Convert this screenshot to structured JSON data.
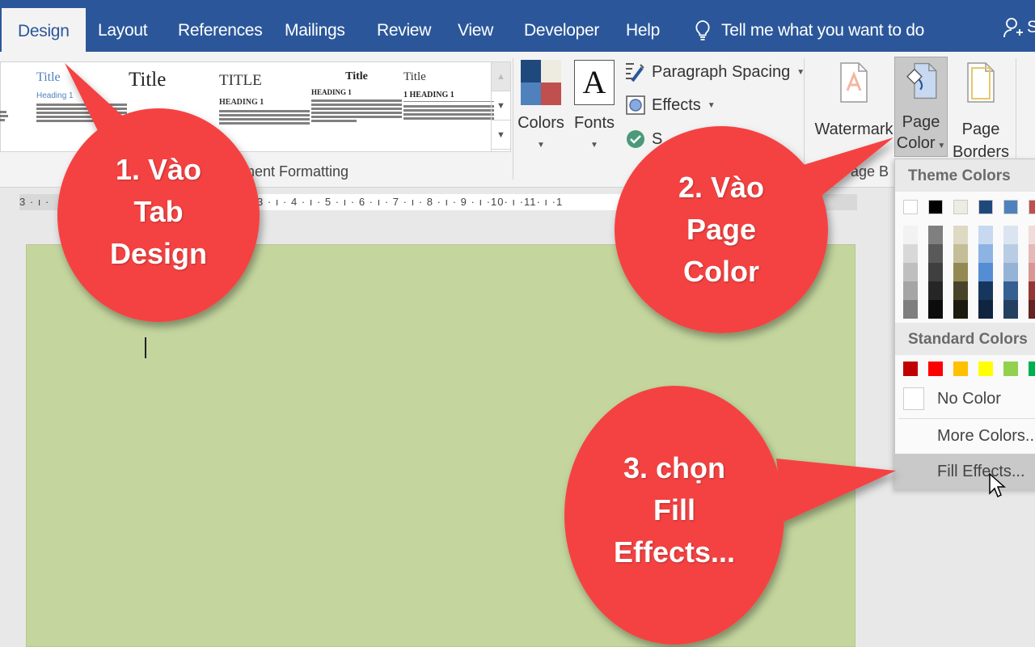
{
  "tabs": [
    {
      "label": "Design",
      "active": true
    },
    {
      "label": "Layout"
    },
    {
      "label": "References"
    },
    {
      "label": "Mailings"
    },
    {
      "label": "Review"
    },
    {
      "label": "View"
    },
    {
      "label": "Developer"
    },
    {
      "label": "Help"
    }
  ],
  "tell_me": {
    "icon": "lightbulb-icon",
    "placeholder": "Tell me what you want to do"
  },
  "share": {
    "icon": "add-person-icon",
    "label": "S"
  },
  "gallery": {
    "thumbnails": [
      {
        "title": "",
        "heading": ""
      },
      {
        "title": "Title",
        "heading": "Heading 1"
      },
      {
        "title": "Title",
        "heading": ""
      },
      {
        "title": "TITLE",
        "heading": "HEADING 1"
      },
      {
        "title": "Title",
        "heading": "HEADING 1"
      },
      {
        "title": "Title",
        "heading": "1  HEADING 1"
      }
    ],
    "group_label": "Document Formatting",
    "group_label_visible": "ment Formatting"
  },
  "ribbon": {
    "colors_label": "Colors",
    "fonts_label": "Fonts",
    "fonts_glyph": "A",
    "paragraph_spacing_label": "Paragraph Spacing",
    "effects_label": "Effects",
    "set_default_label": "S",
    "watermark_label": "Watermark",
    "page_color_label_1": "Page",
    "page_color_label_2": "Color",
    "page_borders_label_1": "Page",
    "page_borders_label_2": "Borders",
    "page_background_group": "Page B"
  },
  "ruler": {
    "left_text": "3 · ı ·",
    "main_text": "3 · ı · 4 · ı · 5 · ı · 6 · ı · 7 · ı · 8 · ı · 9 · ı ·10· ı ·11· ı ·1"
  },
  "page_color_menu": {
    "theme_header": "Theme Colors",
    "theme_top_row": [
      "#ffffff",
      "#000000",
      "#eeece1",
      "#1f497d",
      "#4f81bd",
      "#c0504d",
      "#9bbb59"
    ],
    "theme_shades": [
      [
        "#f2f2f2",
        "#d8d8d8",
        "#bfbfbf",
        "#a5a5a5",
        "#7f7f7f"
      ],
      [
        "#7f7f7f",
        "#595959",
        "#3f3f3f",
        "#262626",
        "#0c0c0c"
      ],
      [
        "#ddd9c3",
        "#c4bd97",
        "#938953",
        "#494429",
        "#1d1b10"
      ],
      [
        "#c6d9f0",
        "#8db3e2",
        "#548dd4",
        "#17365d",
        "#0f243e"
      ],
      [
        "#dbe5f1",
        "#b8cce4",
        "#95b3d7",
        "#366092",
        "#244061"
      ],
      [
        "#f2dcdb",
        "#e5b9b7",
        "#d99694",
        "#953734",
        "#632423"
      ],
      [
        "#ebf1dd",
        "#d7e3bc",
        "#c3d69b",
        "#76923c",
        "#4f6128"
      ]
    ],
    "standard_header": "Standard Colors",
    "standard_colors": [
      "#c00000",
      "#ff0000",
      "#ffc000",
      "#ffff00",
      "#92d050",
      "#00b050",
      "#00b0f0"
    ],
    "no_color": "No Color",
    "more_colors": "More Colors...",
    "fill_effects": "Fill Effects..."
  },
  "callouts": [
    {
      "text": "1. Vào\nTab\nDesign",
      "color": "#f44242"
    },
    {
      "text": "2. Vào\nPage\nColor",
      "color": "#f44242"
    },
    {
      "text": "3. chọn\nFill\nEffects...",
      "color": "#f44242"
    }
  ],
  "colors": {
    "tab_bar": "#2b579a",
    "page_background": "#c4d69e",
    "callout": "#f44242"
  }
}
